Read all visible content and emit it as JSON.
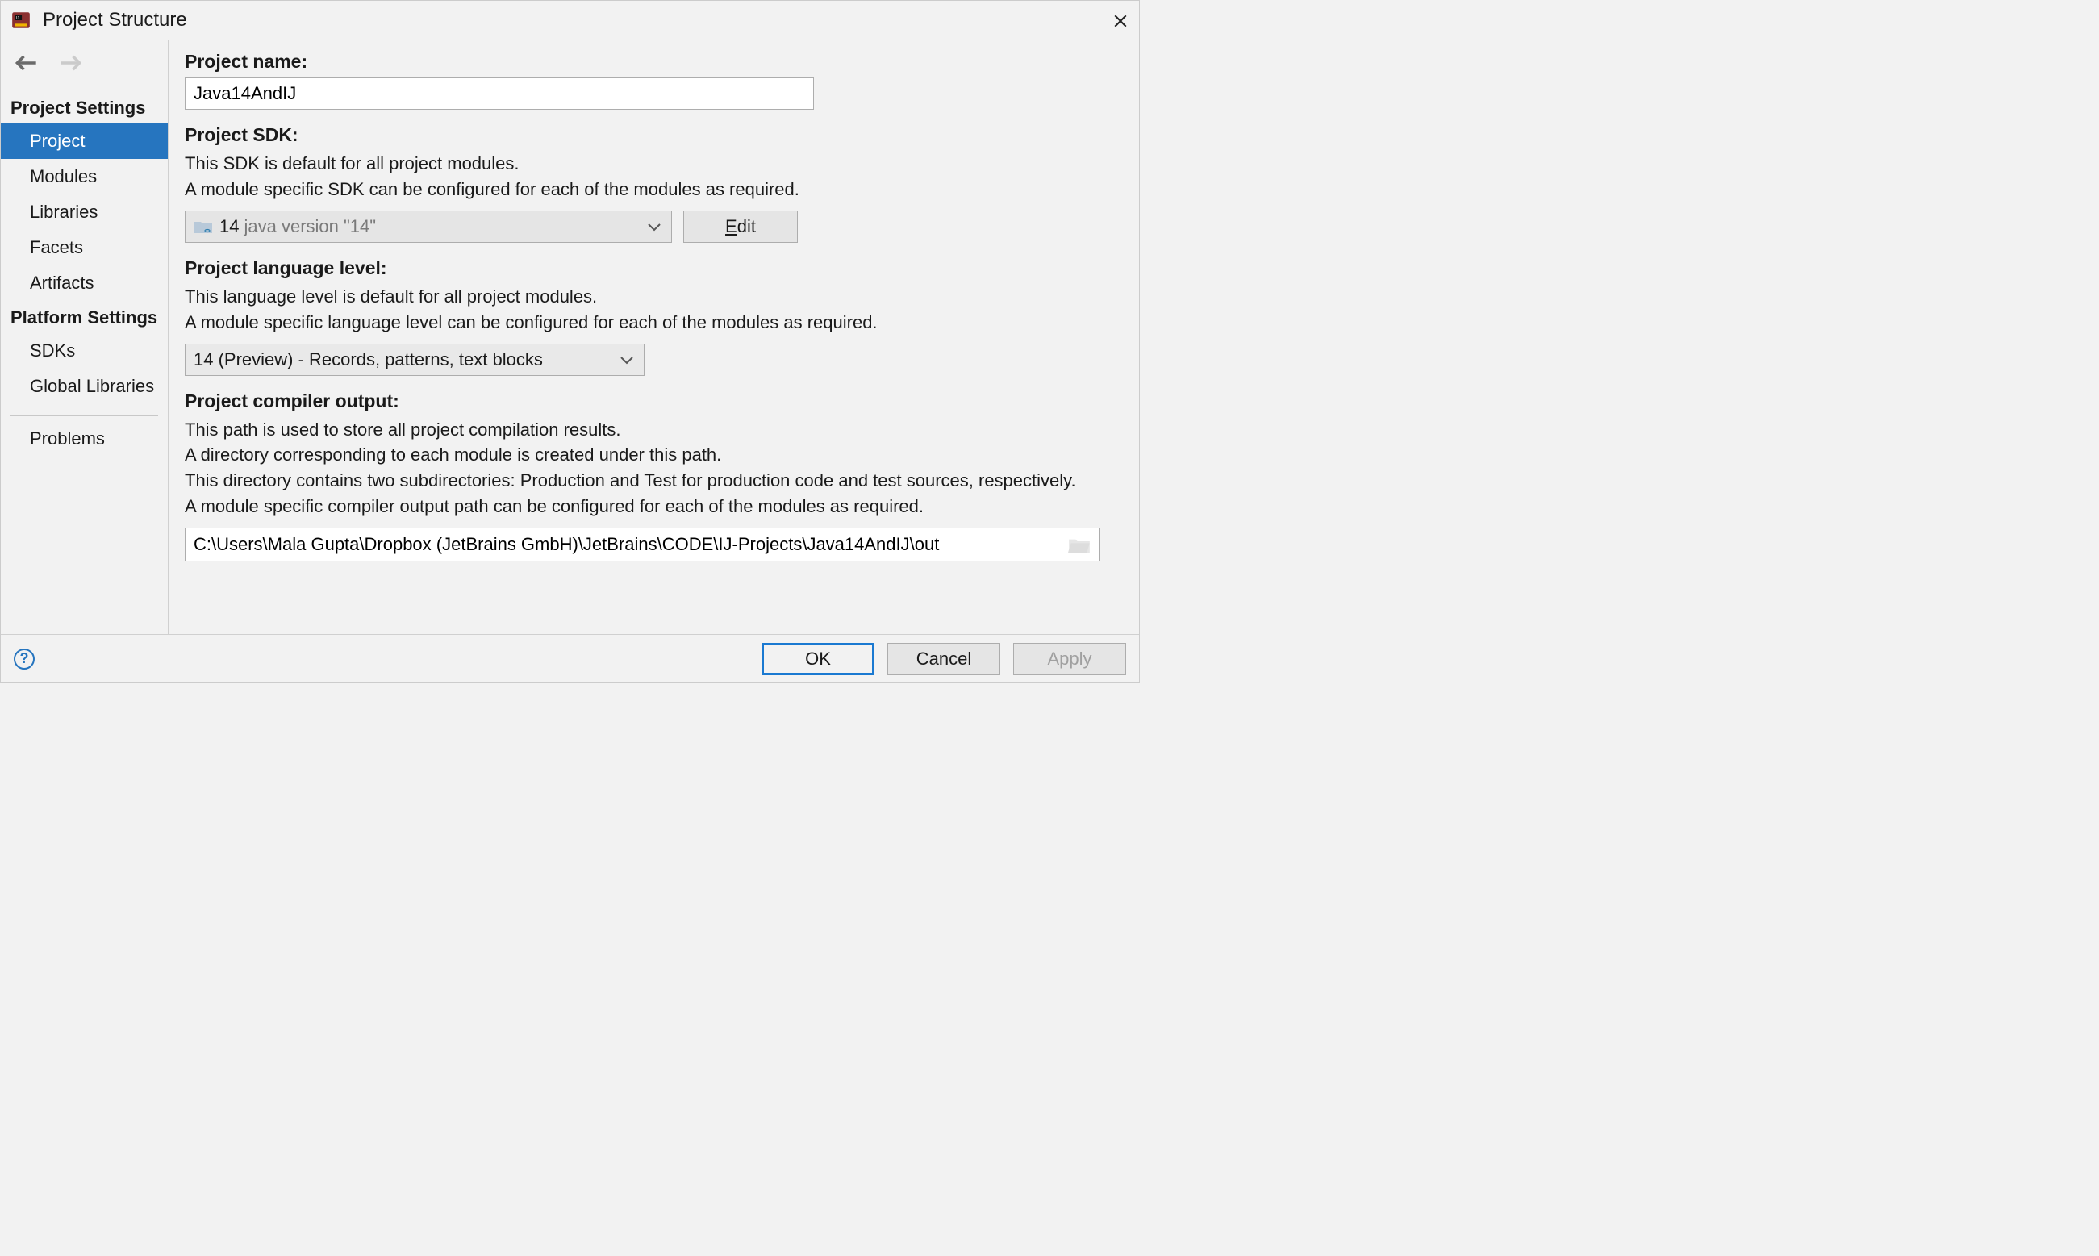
{
  "window": {
    "title": "Project Structure"
  },
  "sidebar": {
    "headings": {
      "project_settings": "Project Settings",
      "platform_settings": "Platform Settings"
    },
    "project_items": [
      "Project",
      "Modules",
      "Libraries",
      "Facets",
      "Artifacts"
    ],
    "platform_items": [
      "SDKs",
      "Global Libraries"
    ],
    "problems": "Problems"
  },
  "main": {
    "project_name": {
      "label": "Project name:",
      "value": "Java14AndIJ"
    },
    "project_sdk": {
      "label": "Project SDK:",
      "desc1": "This SDK is default for all project modules.",
      "desc2": "A module specific SDK can be configured for each of the modules as required.",
      "selected_primary": "14",
      "selected_secondary": "java version \"14\"",
      "edit_label": "Edit"
    },
    "language_level": {
      "label": "Project language level:",
      "desc1": "This language level is default for all project modules.",
      "desc2": "A module specific language level can be configured for each of the modules as required.",
      "selected": "14 (Preview) - Records, patterns, text blocks"
    },
    "compiler_output": {
      "label": "Project compiler output:",
      "desc1": "This path is used to store all project compilation results.",
      "desc2": "A directory corresponding to each module is created under this path.",
      "desc3": "This directory contains two subdirectories: Production and Test for production code and test sources, respectively.",
      "desc4": "A module specific compiler output path can be configured for each of the modules as required.",
      "value": "C:\\Users\\Mala Gupta\\Dropbox (JetBrains GmbH)\\JetBrains\\CODE\\IJ-Projects\\Java14AndIJ\\out"
    }
  },
  "footer": {
    "ok": "OK",
    "cancel": "Cancel",
    "apply": "Apply"
  }
}
